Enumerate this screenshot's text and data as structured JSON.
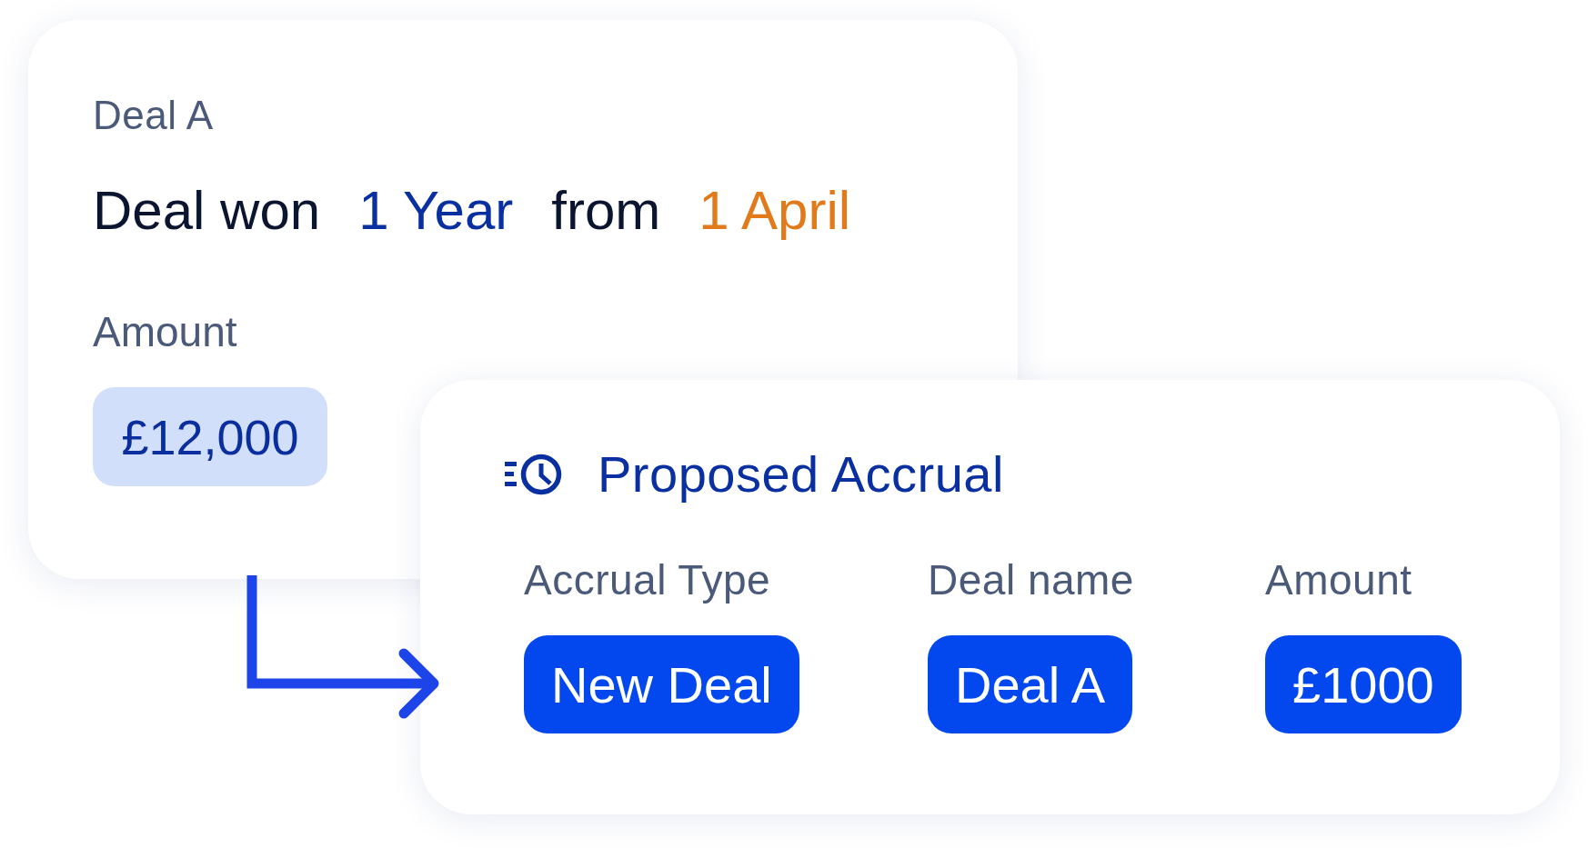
{
  "deal_card": {
    "title": "Deal A",
    "summary": [
      {
        "text": "Deal won",
        "color": "#0b1530"
      },
      {
        "text": "1 Year",
        "color": "#0a2fa0"
      },
      {
        "text": "from",
        "color": "#0b1530"
      },
      {
        "text": "1 April",
        "color": "#e07a1a"
      }
    ],
    "amount_label": "Amount",
    "amount_value": "£12,000"
  },
  "accrual_card": {
    "title": "Proposed Accrual",
    "fields": [
      {
        "label": "Accrual Type",
        "value": "New Deal"
      },
      {
        "label": "Deal name",
        "value": "Deal A"
      },
      {
        "label": "Amount",
        "value": "£1000"
      }
    ]
  }
}
